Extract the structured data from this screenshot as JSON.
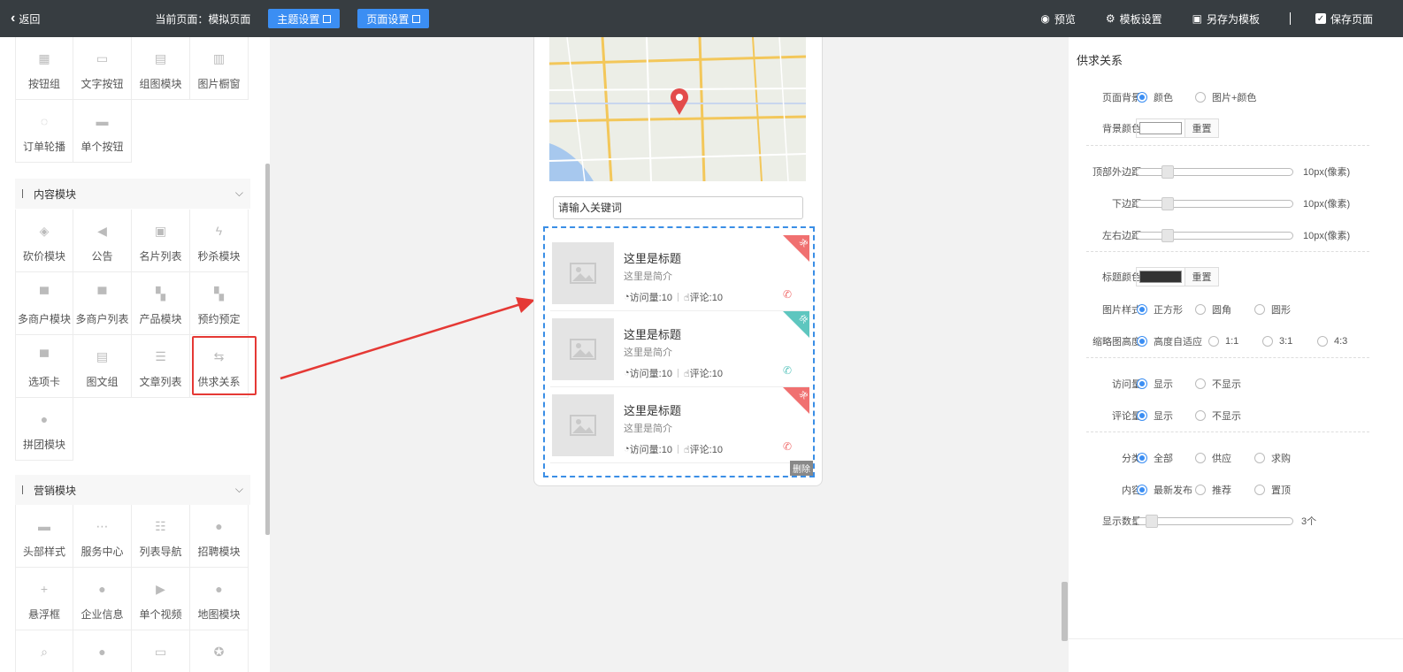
{
  "topbar": {
    "back": "返回",
    "current_page": "当前页面：模拟页面",
    "theme_btn": "主题设置",
    "page_btn": "页面设置",
    "preview": "预览",
    "template_settings": "模板设置",
    "save_template": "另存为模板",
    "save_page": "保存页面"
  },
  "left": {
    "grid1": [
      "按钮组",
      "文字按钮",
      "组图模块",
      "图片橱窗",
      "订单轮播",
      "单个按钮"
    ],
    "section_content": "内容模块",
    "grid2": [
      "砍价模块",
      "公告",
      "名片列表",
      "秒杀模块",
      "多商户模块",
      "多商户列表",
      "产品模块",
      "预约预定",
      "选项卡",
      "图文组",
      "文章列表",
      "供求关系",
      "拼团模块"
    ],
    "section_marketing": "营销模块",
    "grid3": [
      "头部样式",
      "服务中心",
      "列表导航",
      "招聘模块",
      "悬浮框",
      "企业信息",
      "单个视频",
      "地图模块"
    ]
  },
  "phone": {
    "search_placeholder": "请输入关键词",
    "items": [
      {
        "title": "这里是标题",
        "desc": "这里是简介",
        "visits": "访问量:10",
        "comments": "评论:10",
        "tag": "求"
      },
      {
        "title": "这里是标题",
        "desc": "这里是简介",
        "visits": "访问量:10",
        "comments": "评论:10",
        "tag": "供"
      },
      {
        "title": "这里是标题",
        "desc": "这里是简介",
        "visits": "访问量:10",
        "comments": "评论:10",
        "tag": "求"
      }
    ],
    "delete": "删除"
  },
  "right": {
    "title": "供求关系",
    "bg_label": "页面背景",
    "bg_opt1": "颜色",
    "bg_opt2": "图片+颜色",
    "bgcolor_label": "背景颜色",
    "reset": "重置",
    "top_margin_label": "顶部外边距",
    "top_margin_val": "10px(像素)",
    "bottom_margin_label": "下边距",
    "bottom_margin_val": "10px(像素)",
    "lr_margin_label": "左右边距",
    "lr_margin_val": "10px(像素)",
    "title_color_label": "标题颜色",
    "img_style_label": "图片样式",
    "img_style_opts": [
      "正方形",
      "圆角",
      "圆形"
    ],
    "thumb_height_label": "缩略图高度",
    "thumb_height_opts": [
      "高度自适应",
      "1:1",
      "3:1",
      "4:3"
    ],
    "visits_label": "访问量",
    "comments_label": "评论量",
    "show": "显示",
    "hide": "不显示",
    "category_label": "分类",
    "category_opts": [
      "全部",
      "供应",
      "求购"
    ],
    "content_label": "内容",
    "content_opts": [
      "最新发布",
      "推荐",
      "置顶"
    ],
    "count_label": "显示数量",
    "count_val": "3个"
  },
  "colors": {
    "topbar": "#373d41",
    "accent": "#3b8ef3",
    "highlight": "#e53935",
    "tag_red": "#f07070",
    "tag_teal": "#5ec6bf"
  }
}
